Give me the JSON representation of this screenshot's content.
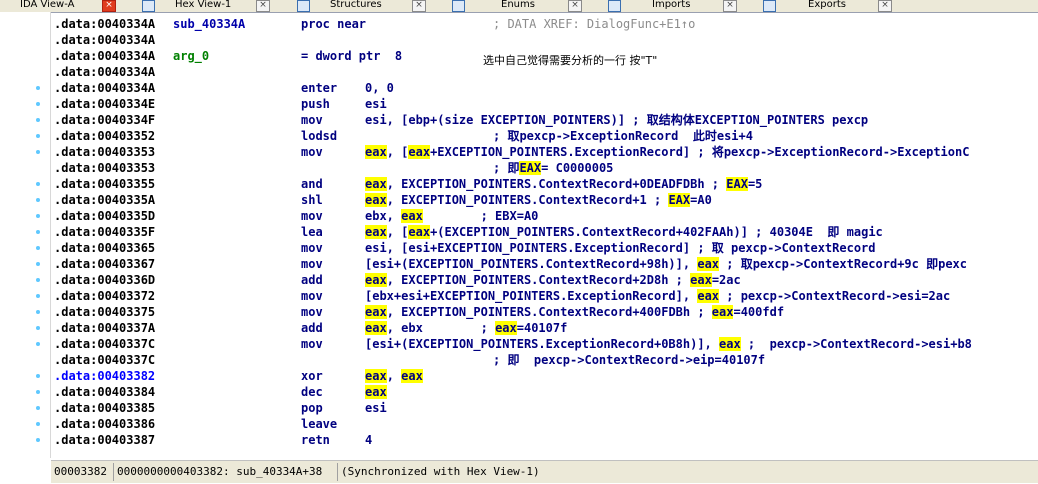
{
  "tabs": [
    {
      "label": "IDA View-A"
    },
    {
      "label": "Hex View-1"
    },
    {
      "label": "Structures"
    },
    {
      "label": "Enums"
    },
    {
      "label": "Imports"
    },
    {
      "label": "Exports"
    }
  ],
  "annotation_note": "选中自己觉得需要分析的一行 按\"T\"",
  "lines": [
    {
      "addr": ".data:0040334A",
      "label": "sub_40334A",
      "mnem": "proc near",
      "ops": "",
      "comment": "; DATA XREF: DialogFunc+E1↑o"
    },
    {
      "addr": ".data:0040334A",
      "label": "",
      "mnem": "",
      "ops": "",
      "comment": ""
    },
    {
      "addr": ".data:0040334A",
      "label": "arg_0",
      "mnem": "= dword ptr  8",
      "ops": "",
      "comment": ""
    },
    {
      "addr": ".data:0040334A",
      "label": "",
      "mnem": "",
      "ops": "",
      "comment": ""
    },
    {
      "addr": ".data:0040334A",
      "label": "",
      "mnem": "enter",
      "ops": "0, 0",
      "comment": ""
    },
    {
      "addr": ".data:0040334E",
      "label": "",
      "mnem": "push",
      "ops": "esi",
      "comment": ""
    },
    {
      "addr": ".data:0040334F",
      "label": "",
      "mnem": "mov",
      "ops": "esi, [ebp+(size EXCEPTION_POINTERS)] ; 取结构体EXCEPTION_POINTERS pexcp",
      "comment": ""
    },
    {
      "addr": ".data:00403352",
      "label": "",
      "mnem": "lodsd",
      "ops": "",
      "comment": "; 取pexcp->ExceptionRecord  此时esi+4"
    },
    {
      "addr": ".data:00403353",
      "label": "",
      "mnem": "mov",
      "ops": "eax, [eax+EXCEPTION_POINTERS.ExceptionRecord] ; 将pexcp->ExceptionRecord->ExceptionC",
      "comment": ""
    },
    {
      "addr": ".data:00403353",
      "label": "",
      "mnem": "",
      "ops": "",
      "comment": "; 即EAX= C0000005"
    },
    {
      "addr": ".data:00403355",
      "label": "",
      "mnem": "and",
      "ops": "eax, EXCEPTION_POINTERS.ContextRecord+0DEADFDBh ; EAX=5",
      "comment": ""
    },
    {
      "addr": ".data:0040335A",
      "label": "",
      "mnem": "shl",
      "ops": "eax, EXCEPTION_POINTERS.ContextRecord+1 ; EAX=A0",
      "comment": ""
    },
    {
      "addr": ".data:0040335D",
      "label": "",
      "mnem": "mov",
      "ops": "ebx, eax        ; EBX=A0",
      "comment": ""
    },
    {
      "addr": ".data:0040335F",
      "label": "",
      "mnem": "lea",
      "ops": "eax, [eax+(EXCEPTION_POINTERS.ContextRecord+402FAAh)] ; 40304E  即 magic",
      "comment": ""
    },
    {
      "addr": ".data:00403365",
      "label": "",
      "mnem": "mov",
      "ops": "esi, [esi+EXCEPTION_POINTERS.ExceptionRecord] ; 取 pexcp->ContextRecord",
      "comment": ""
    },
    {
      "addr": ".data:00403367",
      "label": "",
      "mnem": "mov",
      "ops": "[esi+(EXCEPTION_POINTERS.ContextRecord+98h)], eax ; 取pexcp->ContextRecord+9c 即pexc",
      "comment": ""
    },
    {
      "addr": ".data:0040336D",
      "label": "",
      "mnem": "add",
      "ops": "eax, EXCEPTION_POINTERS.ContextRecord+2D8h ; eax=2ac",
      "comment": ""
    },
    {
      "addr": ".data:00403372",
      "label": "",
      "mnem": "mov",
      "ops": "[ebx+esi+EXCEPTION_POINTERS.ExceptionRecord], eax ; pexcp->ContextRecord->esi=2ac",
      "comment": ""
    },
    {
      "addr": ".data:00403375",
      "label": "",
      "mnem": "mov",
      "ops": "eax, EXCEPTION_POINTERS.ContextRecord+400FDBh ; eax=400fdf",
      "comment": ""
    },
    {
      "addr": ".data:0040337A",
      "label": "",
      "mnem": "add",
      "ops": "eax, ebx        ; eax=40107f",
      "comment": ""
    },
    {
      "addr": ".data:0040337C",
      "label": "",
      "mnem": "mov",
      "ops": "[esi+(EXCEPTION_POINTERS.ExceptionRecord+0B8h)], eax ;  pexcp->ContextRecord->esi+b8",
      "comment": ""
    },
    {
      "addr": ".data:0040337C",
      "label": "",
      "mnem": "",
      "ops": "",
      "comment": "; 即  pexcp->ContextRecord->eip=40107f"
    },
    {
      "addr": ".data:00403382",
      "label": "",
      "mnem": "xor",
      "ops": "eax, eax",
      "comment": ""
    },
    {
      "addr": ".data:00403384",
      "label": "",
      "mnem": "dec",
      "ops": "eax",
      "comment": ""
    },
    {
      "addr": ".data:00403385",
      "label": "",
      "mnem": "pop",
      "ops": "esi",
      "comment": ""
    },
    {
      "addr": ".data:00403386",
      "label": "",
      "mnem": "leave",
      "ops": "",
      "comment": ""
    },
    {
      "addr": ".data:00403387",
      "label": "",
      "mnem": "retn",
      "ops": "4",
      "comment": ""
    }
  ],
  "status": {
    "offset": "00003382",
    "location": "0000000000403382: sub_40334A+38",
    "sync": "(Synchronized with Hex View-1)"
  },
  "colors": {
    "highlight": "#ffff00",
    "code_blue": "#000080",
    "address_current": "#0000ff",
    "tab_close_active": "#e03c1e",
    "gutter_dot": "#5fc8ff"
  }
}
